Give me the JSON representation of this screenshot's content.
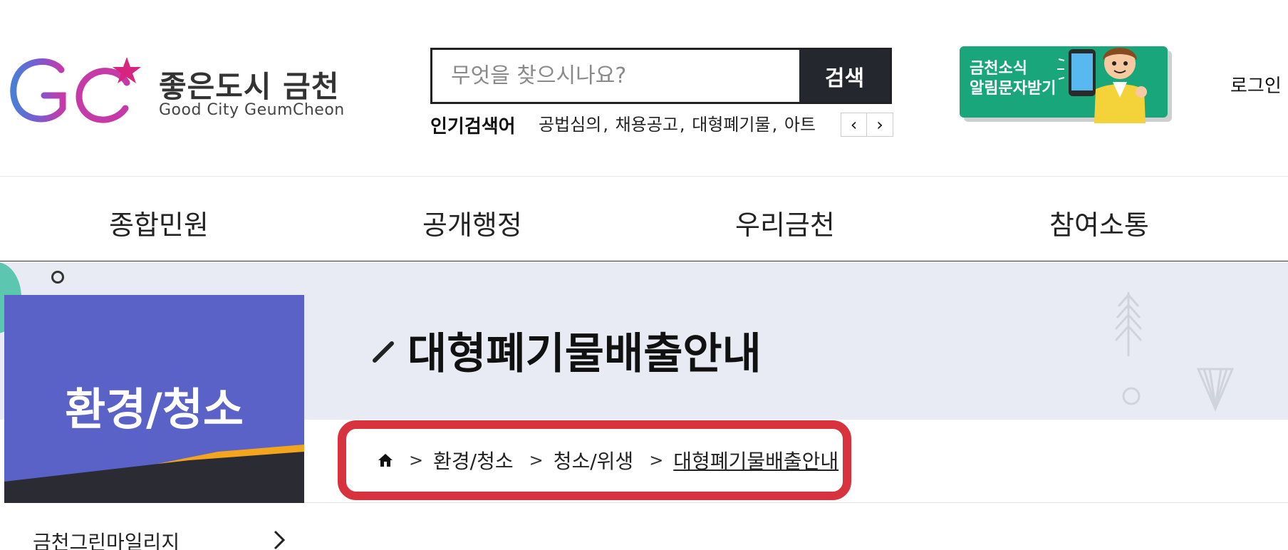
{
  "header": {
    "logo": {
      "korean": "좋은도시 금천",
      "english": "Good City GeumCheon"
    },
    "search": {
      "placeholder": "무엇을 찾으시나요?",
      "button_label": "검색"
    },
    "popular": {
      "label": "인기검색어",
      "keywords": [
        "공법심의",
        "채용공고",
        "대형폐기물",
        "아트"
      ]
    },
    "banner": {
      "line1": "금천소식",
      "line2": "알림문자받기"
    },
    "login_label": "로그인"
  },
  "gnb": {
    "items": [
      "종합민원",
      "공개행정",
      "우리금천",
      "참여소통"
    ]
  },
  "sidebox": {
    "title": "환경/청소"
  },
  "page_title": "대형폐기물배출안내",
  "breadcrumb": {
    "items": [
      "환경/청소",
      "청소/위생",
      "대형폐기물배출안내"
    ],
    "separator": ">"
  },
  "leftmenu": {
    "first_item": "금천그린마일리지"
  },
  "colors": {
    "accent_purple": "#5a62c8",
    "highlight_red": "#d8323f",
    "banner_green": "#19a67a",
    "search_button": "#24272e",
    "visual_bg": "#e8ebf3"
  }
}
